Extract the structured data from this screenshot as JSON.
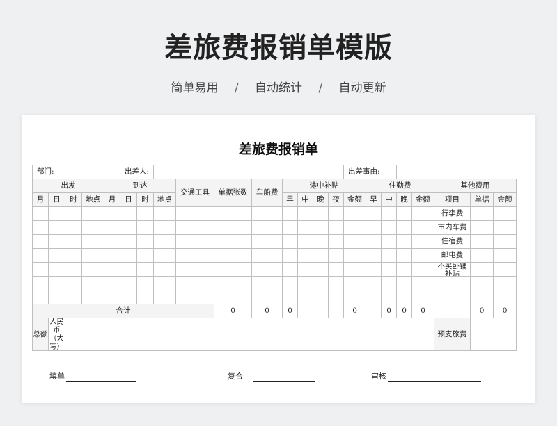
{
  "hero": {
    "title": "差旅费报销单模版",
    "taglines": [
      "简单易用",
      "自动统计",
      "自动更新"
    ],
    "separator": "/"
  },
  "form": {
    "title": "差旅费报销单",
    "info": {
      "dept_label": "部门:",
      "traveler_label": "出差人:",
      "reason_label": "出差事由:"
    },
    "groups": {
      "depart": "出发",
      "arrive": "到达",
      "transport": "交通工具",
      "receipts": "单据张数",
      "fare": "车船费",
      "allowance": "途中补贴",
      "lodging": "住勤费",
      "other": "其他费用"
    },
    "sub": {
      "month": "月",
      "day": "日",
      "hour": "时",
      "place": "地点",
      "breakfast": "早",
      "lunch": "中",
      "dinner": "晚",
      "night": "夜",
      "amount": "金额",
      "item": "项目",
      "receipt": "单据"
    },
    "other_items": [
      "行李费",
      "市内车费",
      "住宿费",
      "邮电费",
      "不买卧铺补贴",
      "",
      ""
    ],
    "total": {
      "label": "合计",
      "receipts": "0",
      "fare": "0",
      "allow_b": "0",
      "allow_amount": "0",
      "lodge_b": "0",
      "lodge_l": "0",
      "lodge_amount": "0",
      "other_receipt": "0",
      "other_amount": "0"
    },
    "grand": {
      "label": "总额",
      "currency": "人民币（大写）",
      "advance": "预支旅费"
    },
    "signatures": {
      "fill": "填单",
      "review": "复合",
      "audit": "审核"
    }
  }
}
